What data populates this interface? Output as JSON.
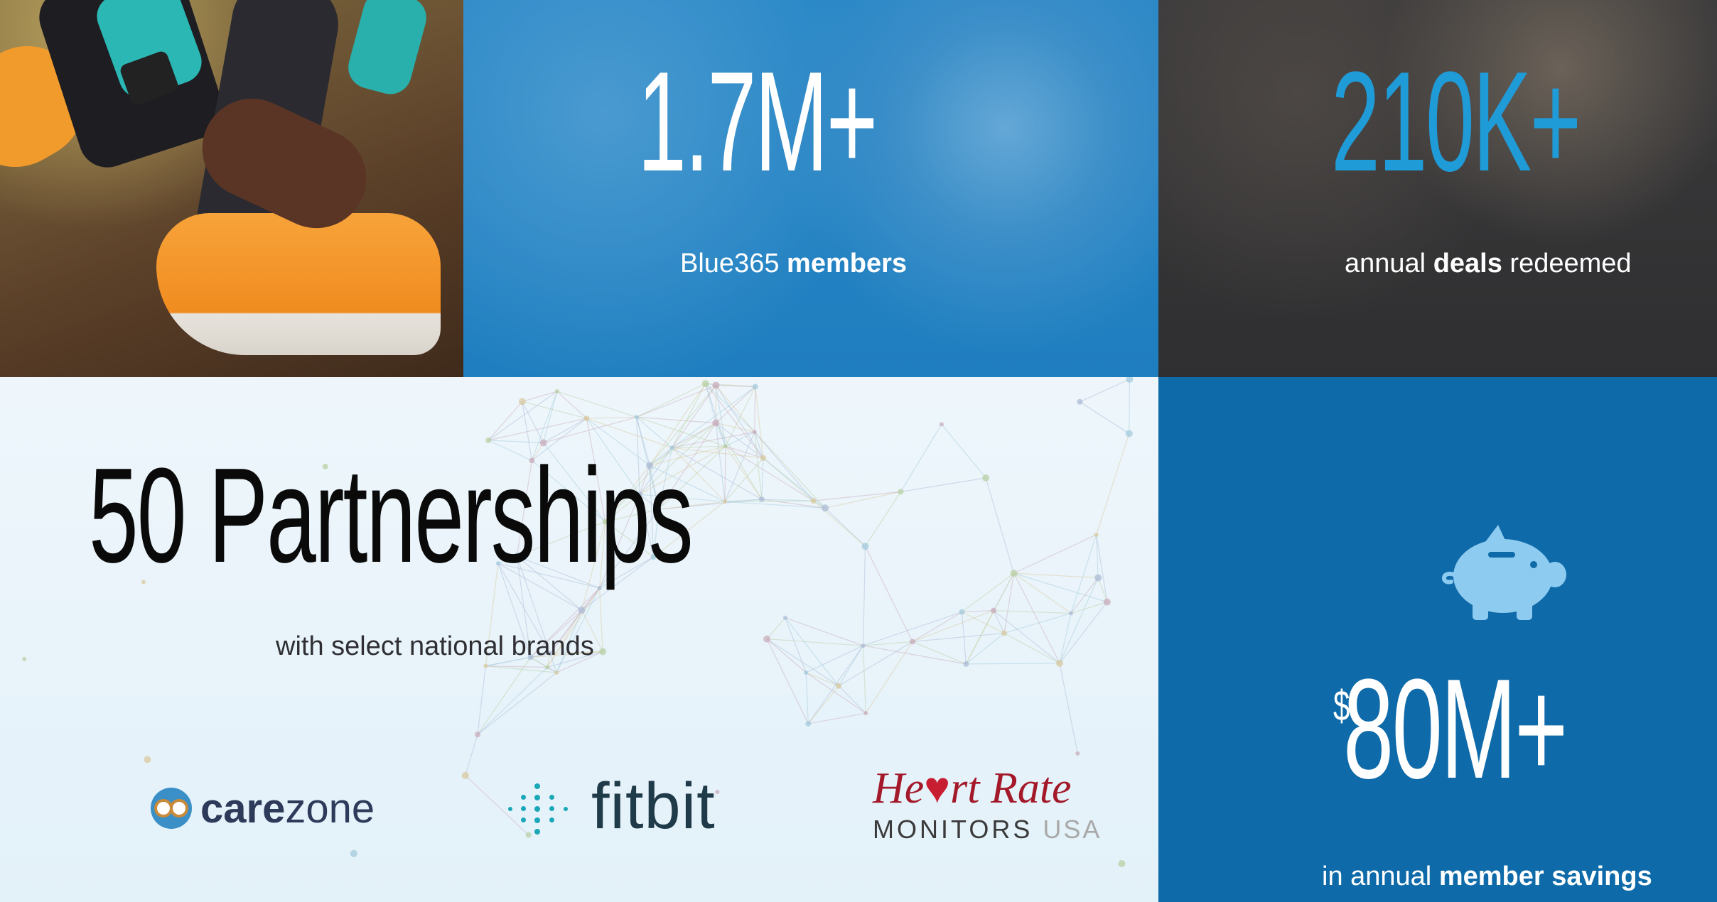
{
  "members": {
    "number": "1.7M+",
    "caption_prefix": "Blue365",
    "caption_bold": "members"
  },
  "deals": {
    "number": "210K+",
    "caption_prefix": "annual",
    "caption_bold": "deals",
    "caption_suffix": "redeemed"
  },
  "partners": {
    "title": "50 Partnerships",
    "subtitle": "with select national brands",
    "logos": {
      "carezone_bold": "care",
      "carezone_light": "zone",
      "fitbit": "fitbit",
      "hrm_line1_a": "He",
      "hrm_heart": "♥",
      "hrm_line1_b": "rt Rate",
      "hrm_line2": "MONITORS",
      "hrm_line2_usa": "USA"
    }
  },
  "savings": {
    "dollar": "$",
    "number": "80M+",
    "caption_prefix": "in annual",
    "caption_bold": "member savings"
  },
  "colors": {
    "members_overlay": "#2381c0",
    "deals_number": "#1f9bd8",
    "deals_overlay": "#333234",
    "partners_bg": "#e6f2f9",
    "savings_bg": "#0e6aa8",
    "piggy": "#8ecbf0"
  },
  "icons": {
    "piggy": "piggy-bank-icon",
    "carezone": "owl-icon",
    "fitbit": "fitbit-dots-icon"
  }
}
